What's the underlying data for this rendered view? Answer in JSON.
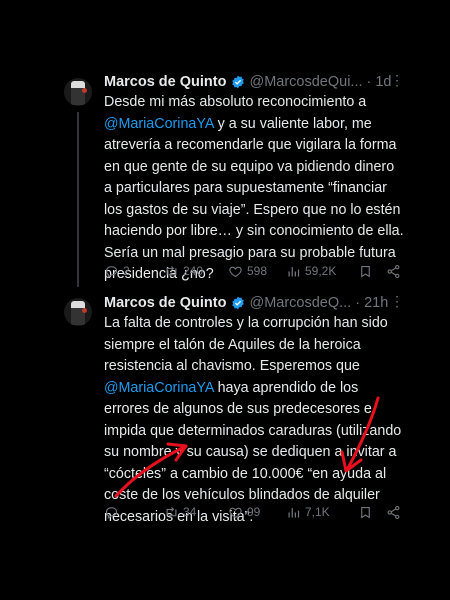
{
  "tweets": [
    {
      "author": "Marcos de Quinto",
      "handle": "@MarcosdeQui...",
      "dot": "·",
      "time": "1d",
      "text_parts": [
        "Desde mi más absoluto reconocimiento a ",
        "@MariaCorinaYA",
        " y a su valiente labor, me atrevería a recomendarle que vigilara la forma en que gente de su equipo va pidiendo dinero a particulares para supuestamente “financiar los gastos de su viaje”. Espero que no lo estén haciendo por libre… y sin conocimiento de ella. Sería un mal presagio para su probable futura presidencia ¿no?"
      ],
      "replies": "2",
      "retweets": "240",
      "likes": "598",
      "views": "59,2K"
    },
    {
      "author": "Marcos de Quinto",
      "handle": "@MarcosdeQ...",
      "dot": "·",
      "time": "21h",
      "text_parts": [
        "La falta de controles y la corrupción han sido siempre el talón de Aquiles de la heroica resistencia al chavismo. Esperemos que ",
        "@MariaCorinaYA",
        " haya aprendido de los errores de algunos de sus predecesores e impida que determinados caraduras (utilizando su nombre y su causa) se dediquen a invitar a “cócteles” a cambio de 10.000€ “en ayuda al coste de los vehículos blindados de alquiler necesarios en la visita”."
      ],
      "replies": "",
      "retweets": "34",
      "likes": "99",
      "views": "7,1K"
    }
  ],
  "colors": {
    "background": "#000000",
    "text": "#e7e9ea",
    "muted": "#71767b",
    "link": "#1d9bf0",
    "verified": "#1d9bf0",
    "annotation": "#e8101c"
  },
  "icons": [
    "verified-badge-icon",
    "more-icon",
    "reply-icon",
    "retweet-icon",
    "like-icon",
    "views-icon",
    "bookmark-icon",
    "share-icon"
  ]
}
